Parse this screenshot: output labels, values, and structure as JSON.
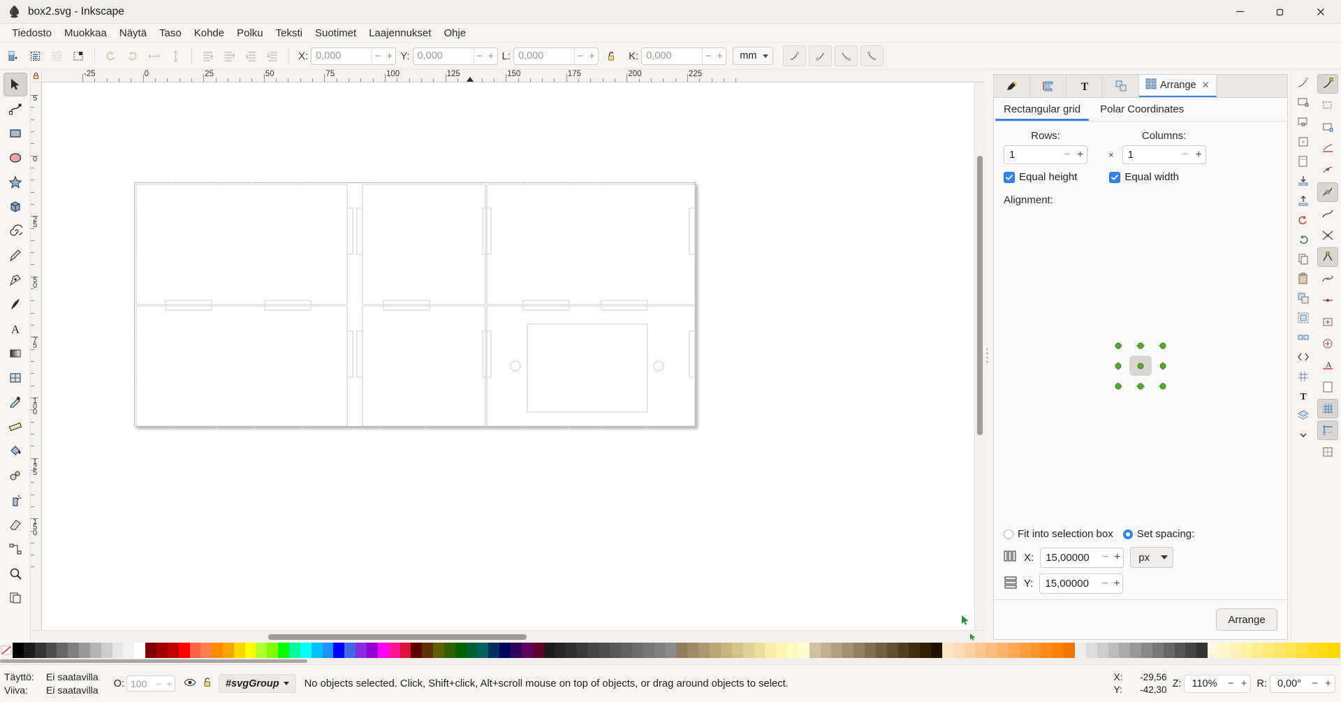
{
  "window": {
    "title": "box2.svg - Inkscape",
    "app_icon": "inkscape-logo-icon",
    "controls": {
      "minimize": "minimize-icon",
      "maximize": "maximize-icon",
      "close": "close-icon"
    }
  },
  "menubar": {
    "items": [
      {
        "label": "Tiedosto",
        "name": "menu-tiedosto"
      },
      {
        "label": "Muokkaa",
        "name": "menu-muokkaa"
      },
      {
        "label": "Näytä",
        "name": "menu-nayta"
      },
      {
        "label": "Taso",
        "name": "menu-taso"
      },
      {
        "label": "Kohde",
        "name": "menu-kohde"
      },
      {
        "label": "Polku",
        "name": "menu-polku"
      },
      {
        "label": "Teksti",
        "name": "menu-teksti"
      },
      {
        "label": "Suotimet",
        "name": "menu-suotimet"
      },
      {
        "label": "Laajennukset",
        "name": "menu-laajennukset"
      },
      {
        "label": "Ohje",
        "name": "menu-ohje"
      }
    ]
  },
  "commandbar": {
    "buttons": [
      {
        "name": "select-all-icon"
      },
      {
        "name": "select-all-layers-icon"
      },
      {
        "name": "deselect-icon"
      },
      {
        "name": "select-same-icon"
      },
      {
        "name": "rotate-ccw-icon"
      },
      {
        "name": "rotate-cw-icon"
      },
      {
        "name": "flip-horizontal-icon"
      },
      {
        "name": "flip-vertical-icon"
      },
      {
        "name": "raise-to-top-icon"
      },
      {
        "name": "raise-icon"
      },
      {
        "name": "lower-icon"
      },
      {
        "name": "lower-to-bottom-icon"
      }
    ],
    "fields": [
      {
        "key": "X:",
        "value": "0,000",
        "name": "x-field"
      },
      {
        "key": "Y:",
        "value": "0,000",
        "name": "y-field"
      },
      {
        "key": "L:",
        "value": "0,000",
        "name": "width-field"
      },
      {
        "key": "K:",
        "value": "0,000",
        "name": "height-field"
      }
    ],
    "lock_icon": "lock-ratio-icon",
    "unit": "mm",
    "snap_buttons": [
      "snap-bbox-icon",
      "snap-bbox-edge-icon",
      "snap-bbox-corner-icon",
      "snap-bbox-edge-mid-icon"
    ]
  },
  "toolbox": {
    "tools": [
      {
        "name": "tool-selector",
        "icon": "arrow-pointer-icon",
        "active": true
      },
      {
        "name": "tool-node",
        "icon": "node-editor-icon",
        "active": false
      },
      {
        "name": "tool-rectangle",
        "icon": "rectangle-icon",
        "active": false
      },
      {
        "name": "tool-ellipse",
        "icon": "ellipse-icon",
        "active": false
      },
      {
        "name": "tool-star",
        "icon": "star-icon",
        "active": false
      },
      {
        "name": "tool-3dbox",
        "icon": "cube-3d-icon",
        "active": false
      },
      {
        "name": "tool-spiral",
        "icon": "spiral-icon",
        "active": false
      },
      {
        "name": "tool-pencil",
        "icon": "pencil-icon",
        "active": false
      },
      {
        "name": "tool-pen",
        "icon": "bezier-pen-icon",
        "active": false
      },
      {
        "name": "tool-calligraphy",
        "icon": "calligraphy-icon",
        "active": false
      },
      {
        "name": "tool-text",
        "icon": "text-a-icon",
        "active": false
      },
      {
        "name": "tool-gradient",
        "icon": "gradient-icon",
        "active": false
      },
      {
        "name": "tool-mesh",
        "icon": "mesh-gradient-icon",
        "active": false
      },
      {
        "name": "tool-dropper",
        "icon": "eyedropper-icon",
        "active": false
      },
      {
        "name": "tool-measure",
        "icon": "measure-ruler-icon",
        "active": false
      },
      {
        "name": "tool-paintbucket",
        "icon": "paint-bucket-icon",
        "active": false
      },
      {
        "name": "tool-tweak",
        "icon": "tweak-icon",
        "active": false
      },
      {
        "name": "tool-spray",
        "icon": "spray-can-icon",
        "active": false
      },
      {
        "name": "tool-eraser",
        "icon": "eraser-icon",
        "active": false
      },
      {
        "name": "tool-connector",
        "icon": "connector-icon",
        "active": false
      },
      {
        "name": "tool-zoom",
        "icon": "magnifier-icon",
        "active": false
      },
      {
        "name": "tool-pages",
        "icon": "pages-icon",
        "active": false
      }
    ],
    "lock_icon": "ruler-lock-icon"
  },
  "rulers": {
    "horizontal_labels": [
      "-25",
      "0",
      "25",
      "50",
      "75",
      "100",
      "125",
      "150",
      "175",
      "200",
      "225"
    ],
    "vertical_labels": [
      "5",
      "0",
      "2",
      "5",
      "5",
      "0",
      "7",
      "5",
      "1",
      "0",
      "0",
      "1",
      "2",
      "5",
      "1",
      "5",
      "0"
    ],
    "unit": "mm"
  },
  "dock": {
    "tabs": [
      {
        "label": "",
        "icon": "xml-editor-icon",
        "name": "tab-xml-editor",
        "active": false
      },
      {
        "label": "",
        "icon": "objects-list-icon",
        "name": "tab-objects",
        "active": false
      },
      {
        "label": "",
        "icon": "text-and-font-icon",
        "name": "tab-text-font",
        "active": false
      },
      {
        "label": "",
        "icon": "clone-tiled-icon",
        "name": "tab-tiled-clones",
        "active": false
      },
      {
        "label": "Arrange",
        "icon": "arrange-icon",
        "name": "tab-arrange",
        "active": true,
        "closable": true
      }
    ],
    "arrange": {
      "subtabs": [
        {
          "label": "Rectangular grid",
          "name": "subtab-rectangular-grid",
          "active": true
        },
        {
          "label": "Polar Coordinates",
          "name": "subtab-polar-coordinates",
          "active": false
        }
      ],
      "rows_label": "Rows:",
      "rows_value": "1",
      "columns_label": "Columns:",
      "columns_value": "1",
      "multiply_symbol": "×",
      "equal_height_label": "Equal height",
      "equal_height_checked": true,
      "equal_width_label": "Equal width",
      "equal_width_checked": true,
      "alignment_label": "Alignment:",
      "alignment_selected_index": 4,
      "fit_label": "Fit into selection box",
      "fit_selected": false,
      "spacing_label": "Set spacing:",
      "spacing_selected": true,
      "spacing_x_label": "X:",
      "spacing_x_value": "15,00000",
      "spacing_x_icon": "columns-spacing-icon",
      "spacing_y_label": "Y:",
      "spacing_y_value": "15,00000",
      "spacing_y_icon": "rows-spacing-icon",
      "unit": "px",
      "arrange_button": "Arrange"
    }
  },
  "snapbar": {
    "buttons": [
      {
        "name": "snap-enable-icon",
        "on": true
      },
      {
        "name": "snap-bbox-icon",
        "on": false
      },
      {
        "name": "snap-bbox-corner-icon",
        "on": false
      },
      {
        "name": "snap-bbox-edge-icon",
        "on": false
      },
      {
        "name": "snap-bbox-midpoint-icon",
        "on": false
      },
      {
        "name": "snap-node-icon",
        "on": true
      },
      {
        "name": "snap-path-icon",
        "on": false
      },
      {
        "name": "snap-path-intersection-icon",
        "on": false
      },
      {
        "name": "snap-cusp-node-icon",
        "on": true
      },
      {
        "name": "snap-smooth-node-icon",
        "on": false
      },
      {
        "name": "snap-midpoint-icon",
        "on": false
      },
      {
        "name": "snap-object-center-icon",
        "on": false
      },
      {
        "name": "snap-rotation-center-icon",
        "on": false
      },
      {
        "name": "snap-text-baseline-icon",
        "on": false
      },
      {
        "name": "snap-page-border-icon",
        "on": false
      },
      {
        "name": "snap-grid-icon",
        "on": true
      },
      {
        "name": "snap-guide-icon",
        "on": true
      },
      {
        "name": "snap-grid-guide-icon",
        "on": false
      }
    ]
  },
  "palette": {
    "none_icon": "no-color-icon",
    "colors": [
      "#000000",
      "#1a1a1a",
      "#333333",
      "#4d4d4d",
      "#666666",
      "#808080",
      "#999999",
      "#b3b3b3",
      "#cccccc",
      "#e6e6e6",
      "#f2f2f2",
      "#ffffff",
      "#800000",
      "#a00000",
      "#c00000",
      "#ff0000",
      "#ff6347",
      "#ff7f50",
      "#ff8c00",
      "#ffa500",
      "#ffd700",
      "#ffff00",
      "#adff2f",
      "#7fff00",
      "#00ff00",
      "#00fa9a",
      "#00ffff",
      "#00bfff",
      "#1e90ff",
      "#0000ff",
      "#4169e1",
      "#8a2be2",
      "#9400d3",
      "#ff00ff",
      "#ff1493",
      "#dc143c",
      "#5f0000",
      "#5f2f00",
      "#5f5f00",
      "#2f5f00",
      "#005f00",
      "#005f2f",
      "#005f5f",
      "#002f5f",
      "#00005f",
      "#2f005f",
      "#5f005f",
      "#5f002f",
      "#1b1b1b",
      "#262626",
      "#303030",
      "#3a3a3a",
      "#444444",
      "#4e4e4e",
      "#585858",
      "#626262",
      "#6c6c6c",
      "#767676",
      "#808080",
      "#8a8a8a",
      "#947c5a",
      "#a08a63",
      "#ad986d",
      "#b9a676",
      "#c6b480",
      "#d2c289",
      "#dfd093",
      "#ebde9c",
      "#f8eca6",
      "#fff5b0",
      "#fffabf",
      "#fffdd0",
      "#d0c0a0",
      "#c0b090",
      "#b0a080",
      "#a09070",
      "#908060",
      "#807050",
      "#706040",
      "#605030",
      "#504020",
      "#403010",
      "#302000",
      "#201000",
      "#ffe4c4",
      "#ffdab9",
      "#ffd0a5",
      "#ffc691",
      "#ffbc7d",
      "#ffb269",
      "#ffa855",
      "#ff9e41",
      "#ff942d",
      "#ff8a19",
      "#ff8005",
      "#f07600",
      "#eeeeee",
      "#dddddd",
      "#cccccc",
      "#bbbbbb",
      "#aaaaaa",
      "#999999",
      "#888888",
      "#777777",
      "#666666",
      "#555555",
      "#444444",
      "#333333",
      "#fff8dc",
      "#fff5c8",
      "#fff2b4",
      "#ffefa0",
      "#ffec8c",
      "#ffe978",
      "#ffe664",
      "#ffe350",
      "#ffe03c",
      "#ffdd28",
      "#ffda14",
      "#ffd700"
    ]
  },
  "statusbar": {
    "fill_label": "Täyttö:",
    "fill_value": "Ei saatavilla",
    "stroke_label": "Viiva:",
    "stroke_value": "Ei saatavilla",
    "opacity_label": "O:",
    "opacity_value": "100",
    "eye_icon": "eye-visible-icon",
    "lock_icon": "layer-unlocked-icon",
    "layer_name": "#svgGroup",
    "layer_caret": "chevron-down-icon",
    "message": "No objects selected. Click, Shift+click, Alt+scroll mouse on top of objects, or drag around objects to select.",
    "cursor_x_label": "X:",
    "cursor_x_value": "-29,56",
    "cursor_y_label": "Y:",
    "cursor_y_value": "-42,30",
    "zoom_label": "Z:",
    "zoom_value": "110%",
    "rotation_label": "R:",
    "rotation_value": "0,00°"
  }
}
